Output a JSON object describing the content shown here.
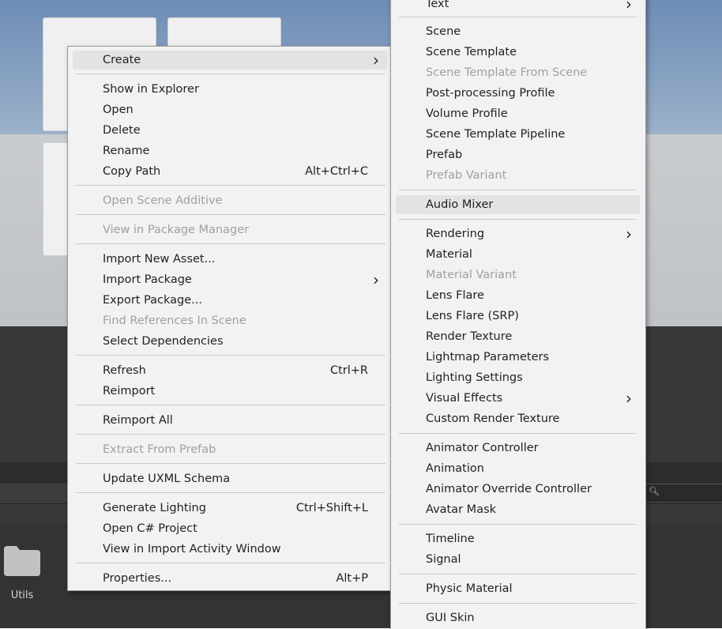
{
  "project_panel": {
    "folder_label": "Utils"
  },
  "main_menu": {
    "items": [
      {
        "label": "Create",
        "shortcut": "",
        "submenu": true,
        "disabled": false,
        "highlight": true
      },
      {
        "label": "Show in Explorer",
        "shortcut": "",
        "submenu": false,
        "disabled": false
      },
      {
        "label": "Open",
        "shortcut": "",
        "submenu": false,
        "disabled": false
      },
      {
        "label": "Delete",
        "shortcut": "",
        "submenu": false,
        "disabled": false
      },
      {
        "label": "Rename",
        "shortcut": "",
        "submenu": false,
        "disabled": false
      },
      {
        "label": "Copy Path",
        "shortcut": "Alt+Ctrl+C",
        "submenu": false,
        "disabled": false
      },
      {
        "label": "Open Scene Additive",
        "shortcut": "",
        "submenu": false,
        "disabled": true
      },
      {
        "label": "View in Package Manager",
        "shortcut": "",
        "submenu": false,
        "disabled": true
      },
      {
        "label": "Import New Asset...",
        "shortcut": "",
        "submenu": false,
        "disabled": false
      },
      {
        "label": "Import Package",
        "shortcut": "",
        "submenu": true,
        "disabled": false
      },
      {
        "label": "Export Package...",
        "shortcut": "",
        "submenu": false,
        "disabled": false
      },
      {
        "label": "Find References In Scene",
        "shortcut": "",
        "submenu": false,
        "disabled": true
      },
      {
        "label": "Select Dependencies",
        "shortcut": "",
        "submenu": false,
        "disabled": false
      },
      {
        "label": "Refresh",
        "shortcut": "Ctrl+R",
        "submenu": false,
        "disabled": false
      },
      {
        "label": "Reimport",
        "shortcut": "",
        "submenu": false,
        "disabled": false
      },
      {
        "label": "Reimport All",
        "shortcut": "",
        "submenu": false,
        "disabled": false
      },
      {
        "label": "Extract From Prefab",
        "shortcut": "",
        "submenu": false,
        "disabled": true
      },
      {
        "label": "Update UXML Schema",
        "shortcut": "",
        "submenu": false,
        "disabled": false
      },
      {
        "label": "Generate Lighting",
        "shortcut": "Ctrl+Shift+L",
        "submenu": false,
        "disabled": false
      },
      {
        "label": "Open C# Project",
        "shortcut": "",
        "submenu": false,
        "disabled": false
      },
      {
        "label": "View in Import Activity Window",
        "shortcut": "",
        "submenu": false,
        "disabled": false
      },
      {
        "label": "Properties...",
        "shortcut": "Alt+P",
        "submenu": false,
        "disabled": false
      }
    ]
  },
  "create_submenu": {
    "items": [
      {
        "label": "Text",
        "submenu": true,
        "disabled": false
      },
      {
        "label": "Scene",
        "submenu": false,
        "disabled": false
      },
      {
        "label": "Scene Template",
        "submenu": false,
        "disabled": false
      },
      {
        "label": "Scene Template From Scene",
        "submenu": false,
        "disabled": true
      },
      {
        "label": "Post-processing Profile",
        "submenu": false,
        "disabled": false
      },
      {
        "label": "Volume Profile",
        "submenu": false,
        "disabled": false
      },
      {
        "label": "Scene Template Pipeline",
        "submenu": false,
        "disabled": false
      },
      {
        "label": "Prefab",
        "submenu": false,
        "disabled": false
      },
      {
        "label": "Prefab Variant",
        "submenu": false,
        "disabled": true
      },
      {
        "label": "Audio Mixer",
        "submenu": false,
        "disabled": false,
        "highlight": true
      },
      {
        "label": "Rendering",
        "submenu": true,
        "disabled": false
      },
      {
        "label": "Material",
        "submenu": false,
        "disabled": false
      },
      {
        "label": "Material Variant",
        "submenu": false,
        "disabled": true
      },
      {
        "label": "Lens Flare",
        "submenu": false,
        "disabled": false
      },
      {
        "label": "Lens Flare (SRP)",
        "submenu": false,
        "disabled": false
      },
      {
        "label": "Render Texture",
        "submenu": false,
        "disabled": false
      },
      {
        "label": "Lightmap Parameters",
        "submenu": false,
        "disabled": false
      },
      {
        "label": "Lighting Settings",
        "submenu": false,
        "disabled": false
      },
      {
        "label": "Visual Effects",
        "submenu": true,
        "disabled": false
      },
      {
        "label": "Custom Render Texture",
        "submenu": false,
        "disabled": false
      },
      {
        "label": "Animator Controller",
        "submenu": false,
        "disabled": false
      },
      {
        "label": "Animation",
        "submenu": false,
        "disabled": false
      },
      {
        "label": "Animator Override Controller",
        "submenu": false,
        "disabled": false
      },
      {
        "label": "Avatar Mask",
        "submenu": false,
        "disabled": false
      },
      {
        "label": "Timeline",
        "submenu": false,
        "disabled": false
      },
      {
        "label": "Signal",
        "submenu": false,
        "disabled": false
      },
      {
        "label": "Physic Material",
        "submenu": false,
        "disabled": false
      },
      {
        "label": "GUI Skin",
        "submenu": false,
        "disabled": false
      }
    ]
  },
  "icons": {
    "submenu_arrow": "chevron-right-icon",
    "search": "search-icon",
    "folder": "folder-icon"
  }
}
